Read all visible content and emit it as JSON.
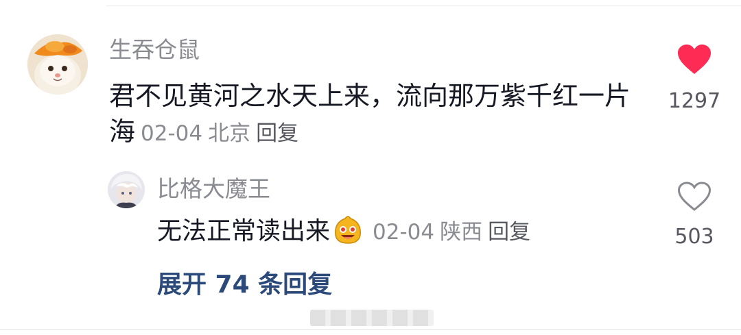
{
  "main_comment": {
    "username": "生吞仓鼠",
    "text": "君不见黄河之水天上来，流向那万紫千红一片海",
    "date": "02-04",
    "location": "北京",
    "reply_label": "回复",
    "like_count": "1297",
    "liked": true,
    "like_color": "#fe2c55",
    "avatar_icon": "cat-avatar-icon"
  },
  "sub_comment": {
    "username": "比格大魔王",
    "text": "无法正常读出来",
    "emoji_icon": "grinning-emoji-icon",
    "date": "02-04",
    "location": "陕西",
    "reply_label": "回复",
    "like_count": "503",
    "liked": false,
    "avatar_icon": "anime-avatar-icon"
  },
  "expand_replies": "展开 74 条回复",
  "accent_color": "#2b4a7a"
}
